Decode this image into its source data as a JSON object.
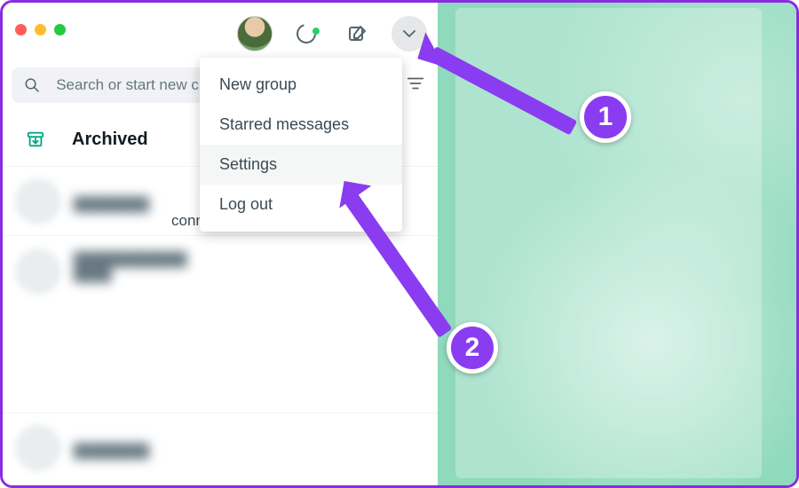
{
  "header": {
    "status_icon": "status-ring-icon",
    "compose_icon": "compose-icon",
    "menu_icon": "chevron-down-icon"
  },
  "search": {
    "placeholder": "Search or start new chat",
    "filter_icon": "filter-icon"
  },
  "archived": {
    "label": "Archived"
  },
  "chat_preview": {
    "status_text": "connecting"
  },
  "dropdown": {
    "items": [
      {
        "label": "New group"
      },
      {
        "label": "Starred messages"
      },
      {
        "label": "Settings"
      },
      {
        "label": "Log out"
      }
    ]
  },
  "annotations": {
    "step1": "1",
    "step2": "2"
  },
  "colors": {
    "accent_purple": "#8a3cf0",
    "brand_green": "#25d366",
    "bg_teal": "#8fd9bd"
  }
}
